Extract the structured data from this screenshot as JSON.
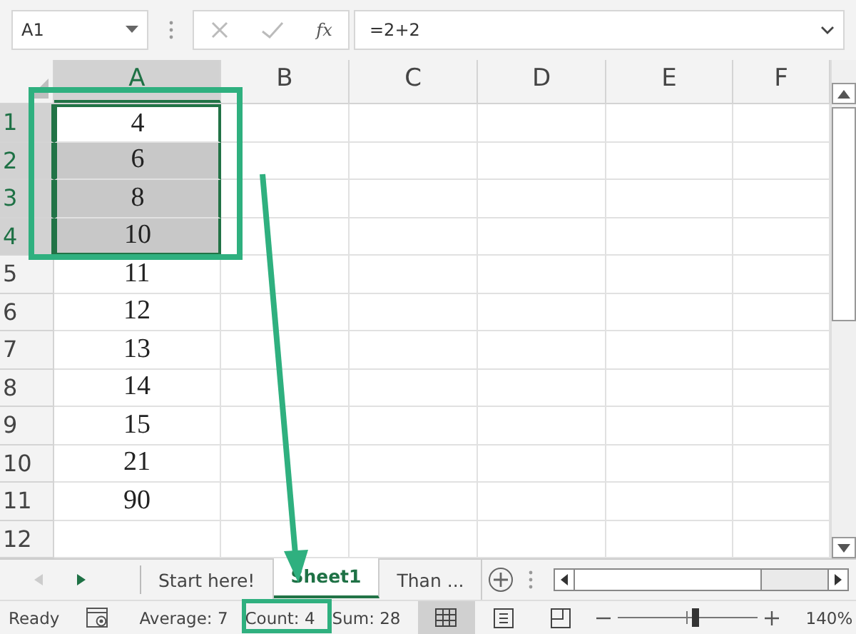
{
  "formula_bar": {
    "name_box": "A1",
    "function_label": "fx",
    "formula": "=2+2"
  },
  "columns": [
    {
      "label": "A",
      "selected": true
    },
    {
      "label": "B",
      "selected": false
    },
    {
      "label": "C",
      "selected": false
    },
    {
      "label": "D",
      "selected": false
    },
    {
      "label": "E",
      "selected": false
    },
    {
      "label": "F",
      "selected": false
    }
  ],
  "rows": [
    {
      "number": "1",
      "value": "4",
      "selected": true
    },
    {
      "number": "2",
      "value": "6",
      "selected": true
    },
    {
      "number": "3",
      "value": "8",
      "selected": true
    },
    {
      "number": "4",
      "value": "10",
      "selected": true
    },
    {
      "number": "5",
      "value": "11",
      "selected": false
    },
    {
      "number": "6",
      "value": "12",
      "selected": false
    },
    {
      "number": "7",
      "value": "13",
      "selected": false
    },
    {
      "number": "8",
      "value": "14",
      "selected": false
    },
    {
      "number": "9",
      "value": "15",
      "selected": false
    },
    {
      "number": "10",
      "value": "21",
      "selected": false
    },
    {
      "number": "11",
      "value": "90",
      "selected": false
    },
    {
      "number": "12",
      "selected": false
    }
  ],
  "sheet_tabs": [
    {
      "label": "Start here!",
      "selected": false
    },
    {
      "label": "Sheet1",
      "selected": true
    },
    {
      "label": "Than ...",
      "selected": false
    }
  ],
  "status_bar": {
    "ready": "Ready",
    "average": "Average: 7",
    "count": "Count: 4",
    "sum": "Sum: 28",
    "views": [
      {
        "kind": "normal",
        "selected": true
      },
      {
        "kind": "page_layout",
        "selected": false
      },
      {
        "kind": "page_break",
        "selected": false
      }
    ],
    "zoom": {
      "level": 0.55,
      "reading": "140%"
    }
  }
}
